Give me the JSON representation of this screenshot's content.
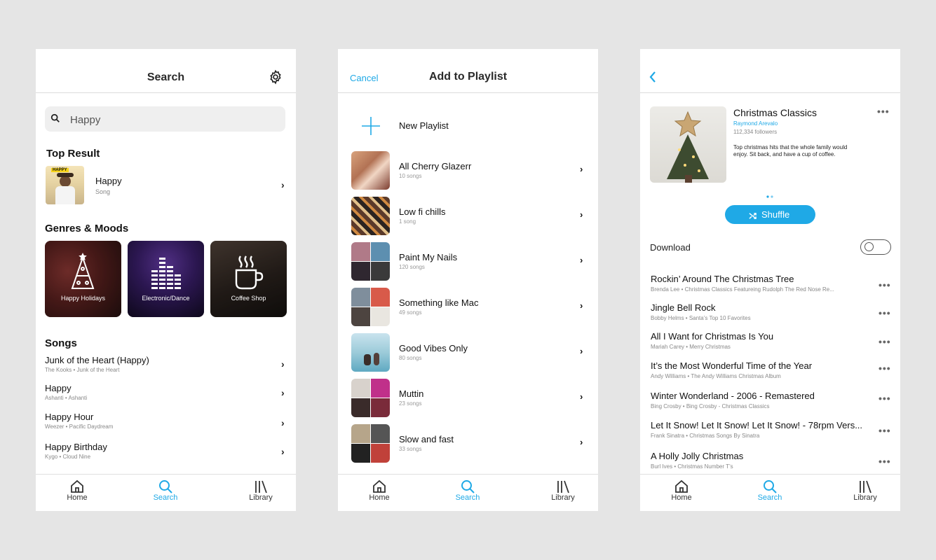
{
  "colors": {
    "accent": "#1fa9e6",
    "background": "#e5e5e5"
  },
  "tabbar": {
    "home": "Home",
    "search": "Search",
    "library": "Library"
  },
  "search_screen": {
    "title": "Search",
    "query": "Happy",
    "top_result_heading": "Top Result",
    "top_result": {
      "title": "Happy",
      "type": "Song",
      "badge": "HAPPY"
    },
    "genres_heading": "Genres & Moods",
    "genres": [
      {
        "label": "Happy Holidays"
      },
      {
        "label": "Electronic/Dance"
      },
      {
        "label": "Coffee Shop"
      }
    ],
    "songs_heading": "Songs",
    "songs": [
      {
        "title": "Junk of the Heart (Happy)",
        "sub": "The Kooks • Junk of the Heart"
      },
      {
        "title": "Happy",
        "sub": "Ashanti • Ashanti"
      },
      {
        "title": "Happy Hour",
        "sub": "Weezer • Pacific Daydream"
      },
      {
        "title": "Happy Birthday",
        "sub": "Kygo • Cloud Nine"
      }
    ]
  },
  "playlist_screen": {
    "cancel": "Cancel",
    "title": "Add to Playlist",
    "new_playlist": "New Playlist",
    "playlists": [
      {
        "name": "All Cherry Glazerr",
        "count": "10 songs"
      },
      {
        "name": "Low fi chills",
        "count": "1 song"
      },
      {
        "name": "Paint My Nails",
        "count": "120 songs"
      },
      {
        "name": "Something like Mac",
        "count": "49 songs"
      },
      {
        "name": "Good Vibes Only",
        "count": "80 songs"
      },
      {
        "name": "Muttin",
        "count": "23 songs"
      },
      {
        "name": "Slow and fast",
        "count": "33 songs"
      }
    ]
  },
  "detail_screen": {
    "playlist_name": "Christmas Classics",
    "owner": "Raymond Arevalo",
    "followers": "112,334 followers",
    "description": "Top christmas hits that the whole family would enjoy. Sit back, and have a cup of coffee.",
    "shuffle": "Shuffle",
    "download": "Download",
    "download_enabled": false,
    "tracks": [
      {
        "title": "Rockin’ Around The Christmas Tree",
        "sub": "Brenda Lee • Christmas Classics Featureing Rudolph The Red Nose Re..."
      },
      {
        "title": "Jingle Bell Rock",
        "sub": "Bobby Helms • Santa’s Top 10 Favorites"
      },
      {
        "title": "All I Want for Christmas Is You",
        "sub": "Mariah Carey • Merry Christmas"
      },
      {
        "title": "It’s the Most Wonderful Time of the Year",
        "sub": "Andy Williams • The Andy Williams Christmas Album"
      },
      {
        "title": "Winter Wonderland - 2006 - Remastered",
        "sub": "Bing Crosby • Bing Crosby - Christmas Classics"
      },
      {
        "title": "Let It Snow! Let It Snow! Let It Snow! - 78rpm Vers...",
        "sub": "Frank Sinatra • Christmas Songs By Sinatra"
      },
      {
        "title": "A Holly Jolly Christmas",
        "sub": "Burl Ives • Christmas Number T’s"
      }
    ]
  }
}
